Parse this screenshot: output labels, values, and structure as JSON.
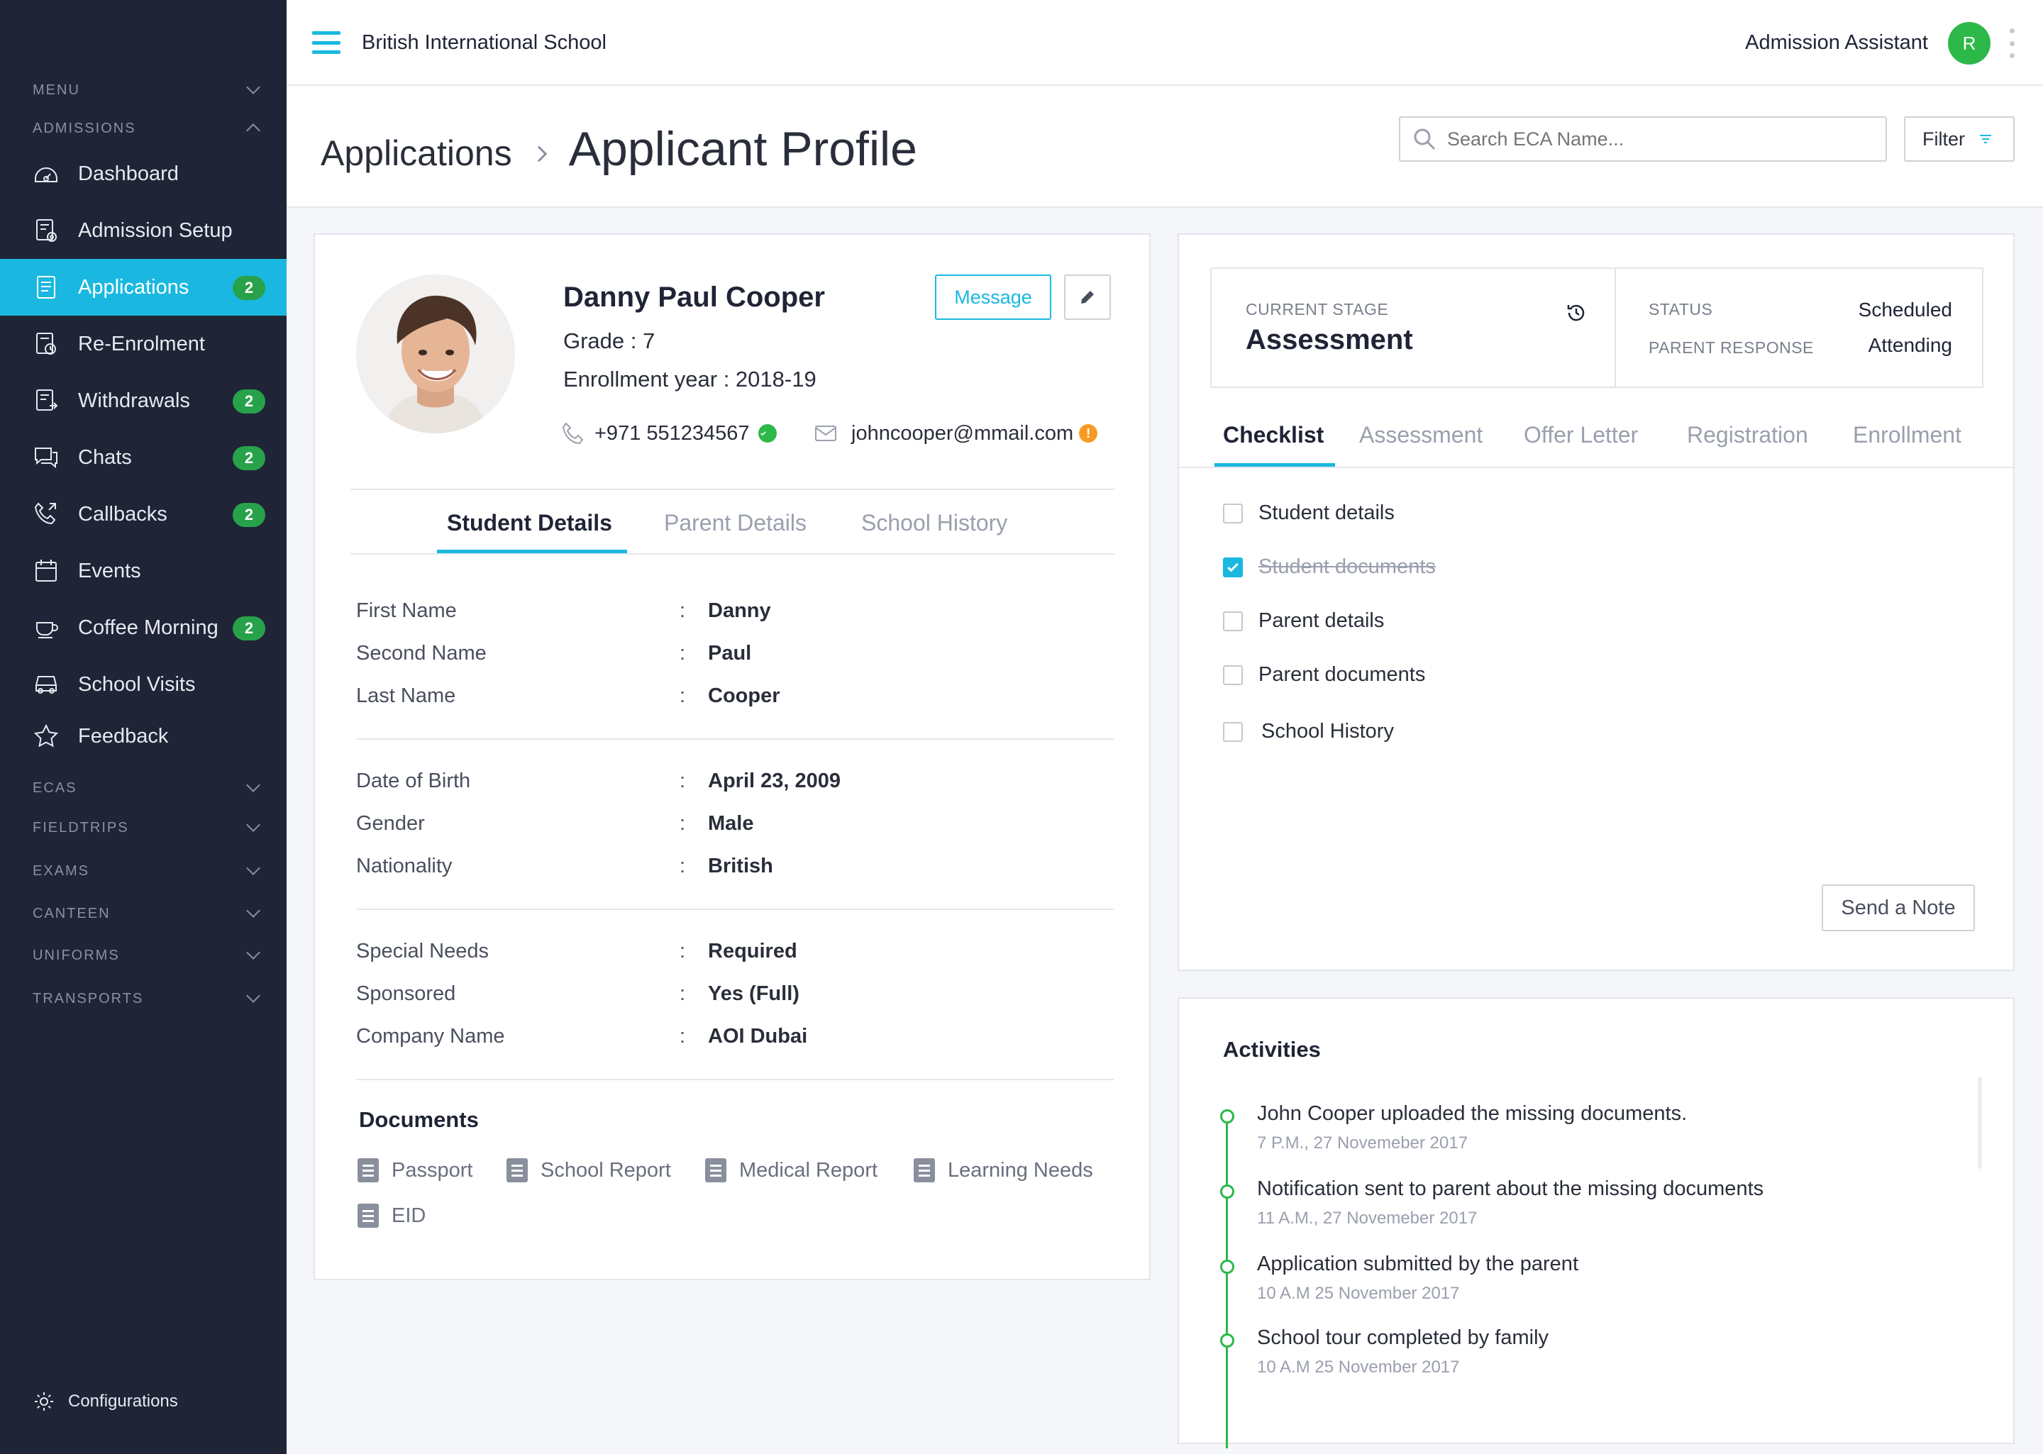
{
  "sidebar": {
    "sections": {
      "menu": "MENU",
      "admissions": "ADMISSIONS",
      "ecas": "ECAS",
      "fieldtrips": "FIELDTRIPS",
      "exams": "EXAMS",
      "canteen": "CANTEEN",
      "uniforms": "UNIFORMS",
      "transports": "TRANSPORTS"
    },
    "items": [
      {
        "label": "Dashboard",
        "icon": "dashboard-icon"
      },
      {
        "label": "Admission Setup",
        "icon": "admission-setup-icon"
      },
      {
        "label": "Applications",
        "icon": "applications-icon",
        "badge": "2",
        "active": true
      },
      {
        "label": "Re-Enrolment",
        "icon": "re-enrolment-icon"
      },
      {
        "label": "Withdrawals",
        "icon": "withdrawals-icon",
        "badge": "2"
      },
      {
        "label": "Chats",
        "icon": "chats-icon",
        "badge": "2"
      },
      {
        "label": "Callbacks",
        "icon": "callbacks-icon",
        "badge": "2"
      },
      {
        "label": "Events",
        "icon": "events-icon"
      },
      {
        "label": "Coffee Morning",
        "icon": "coffee-icon",
        "badge": "2"
      },
      {
        "label": "School Visits",
        "icon": "bus-icon"
      },
      {
        "label": "Feedback",
        "icon": "star-icon"
      }
    ],
    "configurations": "Configurations"
  },
  "topbar": {
    "school_name": "British International School",
    "role": "Admission Assistant",
    "avatar_initial": "R"
  },
  "page_header": {
    "breadcrumb_parent": "Applications",
    "title": "Applicant Profile",
    "search_placeholder": "Search ECA Name...",
    "filter_label": "Filter"
  },
  "profile": {
    "name": "Danny Paul Cooper",
    "grade": "Grade : 7",
    "enrollment_year": "Enrollment year : 2018-19",
    "phone": "+971 551234567",
    "email": "johncooper@mmail.com",
    "message_label": "Message",
    "tabs": [
      "Student Details",
      "Parent Details",
      "School History"
    ],
    "fields": [
      {
        "label": "First Name",
        "value": "Danny"
      },
      {
        "label": "Second Name",
        "value": "Paul"
      },
      {
        "label": "Last Name",
        "value": "Cooper"
      },
      {
        "label": "Date of Birth",
        "value": "April 23, 2009"
      },
      {
        "label": "Gender",
        "value": "Male"
      },
      {
        "label": "Nationality",
        "value": "British"
      },
      {
        "label": "Special Needs",
        "value": "Required"
      },
      {
        "label": "Sponsored",
        "value": "Yes (Full)"
      },
      {
        "label": "Company Name",
        "value": "AOI Dubai"
      }
    ],
    "documents_title": "Documents",
    "documents": [
      "Passport",
      "School Report",
      "Medical Report",
      "Learning Needs",
      "EID"
    ]
  },
  "stage": {
    "current_stage_label": "CURRENT STAGE",
    "current_stage": "Assessment",
    "status_label": "STATUS",
    "status": "Scheduled",
    "parent_response_label": "PARENT RESPONSE",
    "parent_response": "Attending",
    "tabs": [
      "Checklist",
      "Assessment",
      "Offer Letter",
      "Registration",
      "Enrollment"
    ],
    "checklist": [
      {
        "label": "Student details",
        "checked": false
      },
      {
        "label": "Student documents",
        "checked": true
      },
      {
        "label": "Parent details",
        "checked": false
      },
      {
        "label": "Parent documents",
        "checked": false
      },
      {
        "label": "School History",
        "checked": false
      }
    ],
    "send_note_label": "Send a Note"
  },
  "activities": {
    "title": "Activities",
    "items": [
      {
        "text": "John Cooper uploaded the missing documents.",
        "time": "7 P.M., 27 Novemeber 2017"
      },
      {
        "text": "Notification sent to parent about the missing documents",
        "time": "11 A.M., 27 Novemeber 2017"
      },
      {
        "text": "Application submitted by the parent",
        "time": "10 A.M 25 November 2017"
      },
      {
        "text": "School tour completed by family",
        "time": "10 A.M 25 November 2017"
      }
    ]
  },
  "colors": {
    "accent": "#1ab8e0",
    "sidebar_bg": "#1f2436",
    "badge_green": "#27a24a",
    "warning": "#f59b24"
  }
}
